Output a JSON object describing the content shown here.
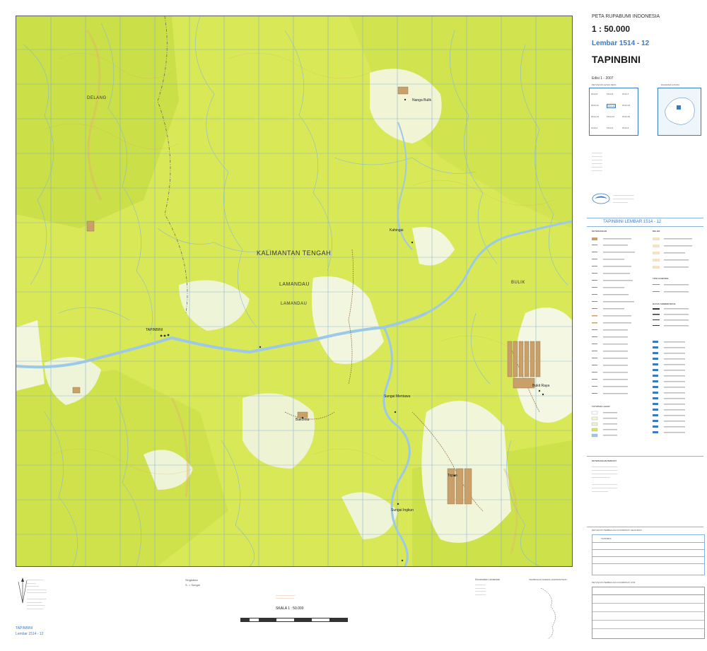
{
  "sheet": {
    "series_title": "PETA RUPABUMI INDONESIA",
    "scale": "1 : 50.000",
    "sheet_number": "Lembar 1514 - 12",
    "sheet_name": "TAPINBINI",
    "edition": "Edisi 1 - 2007",
    "index_caption": "PETUNJUK LETAK PETA",
    "diagram_caption": "DIAGRAM LOKASI",
    "sheet_header_blue": "TAPINBINI LEMBAR 1514 - 12",
    "legend_title": "KETERANGAN",
    "relief_title": "RELIEF",
    "heights_title": "TITIK KONTROL",
    "admin_title": "BATAS ADMINISTRASI",
    "veg_title": "TUTUPAN LAHAN",
    "notes_title": "KETERANGAN RIWAYAT",
    "index_table_title": "PETUNJUK PEMBACAAN KOORDINAT GEOGRAFI",
    "index_table_title2": "PETUNJUK PEMBACAAN KOORDINAT UTM",
    "index_name": "TAPINBINI",
    "bottom_left_name": "TAPINBINI",
    "bottom_left_sheet": "Lembar 1514 - 12",
    "bottom_scale": "SKALA 1 : 50.000",
    "abbreviation_title": "Singkatan",
    "abbreviation_item": "S. = Sungai",
    "district_title": "Kecamatan Lamandau",
    "adjacent_title": "PEMBAGIAN DAERAH ADMINISTRASI"
  },
  "map": {
    "regions": [
      {
        "name": "KALIMANTAN TENGAH"
      },
      {
        "name": "LAMANDAU"
      },
      {
        "name": "LAMANDAU"
      },
      {
        "name": "DELANG"
      },
      {
        "name": "BULIK"
      }
    ],
    "places": [
      {
        "name": "TAPINBINI"
      },
      {
        "name": "Nanga Bulik"
      },
      {
        "name": "Sungai Mentawa"
      },
      {
        "name": "Bukit Raya"
      },
      {
        "name": "Kahingai"
      },
      {
        "name": "Bakonsu"
      },
      {
        "name": "Sungai Ingkun"
      },
      {
        "name": "Topan"
      }
    ],
    "index_sheets": [
      [
        "1514-5",
        "1514-6",
        "1514-7"
      ],
      [
        "1514-11",
        "1514-12",
        "1514-13"
      ],
      [
        "1514-13",
        "1514-14",
        "1514-15"
      ],
      [
        "1414-4",
        "1514-1",
        "1514-2"
      ]
    ]
  },
  "colors": {
    "forest": "#d8e857",
    "forest_dense": "#c9df45",
    "clearing": "#f4f7dc",
    "river": "#9cc9e8",
    "settlement": "#c9a06a",
    "grid": "#7aa8d8",
    "blue_text": "#3a79c8"
  }
}
